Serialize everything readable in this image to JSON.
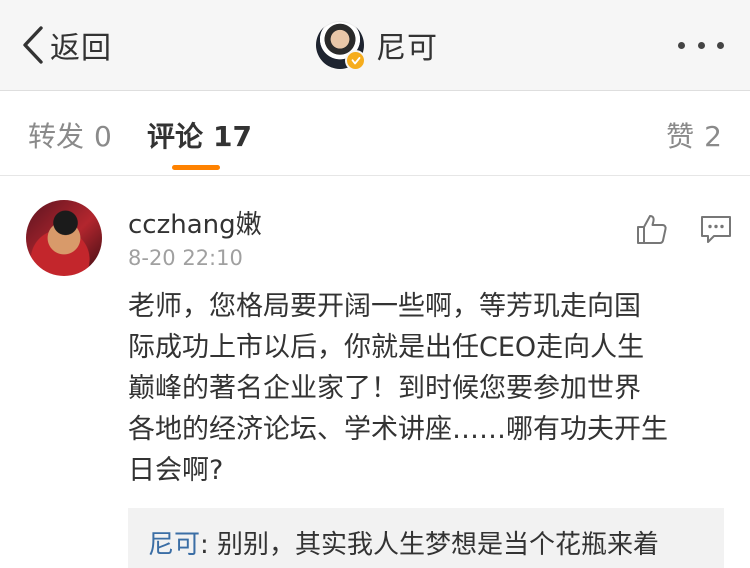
{
  "nav": {
    "back_label": "返回",
    "title": "尼可"
  },
  "tabs": {
    "repost_label": "转发",
    "repost_count": "0",
    "comment_label": "评论",
    "comment_count": "17",
    "like_label": "赞",
    "like_count": "2"
  },
  "comment": {
    "username": "cczhang嫩",
    "time": "8-20 22:10",
    "text": "老师，您格局要开阔一些啊，等芳玑走向国\n际成功上市以后，你就是出任CEO走向人生\n巅峰的著名企业家了！到时候您要参加世界\n各地的经济论坛、学术讲座……哪有功夫开生\n日会啊?",
    "reply": {
      "author": "尼可",
      "separator": ": ",
      "text": "别别，其实我人生梦想是当个花瓶来着"
    }
  },
  "colors": {
    "accent": "#ff8200",
    "link": "#3b6ea5",
    "verified": "#f6ad1d"
  },
  "icons": [
    "back-chevron-icon",
    "verified-icon",
    "more-icon",
    "like-icon",
    "reply-icon"
  ]
}
